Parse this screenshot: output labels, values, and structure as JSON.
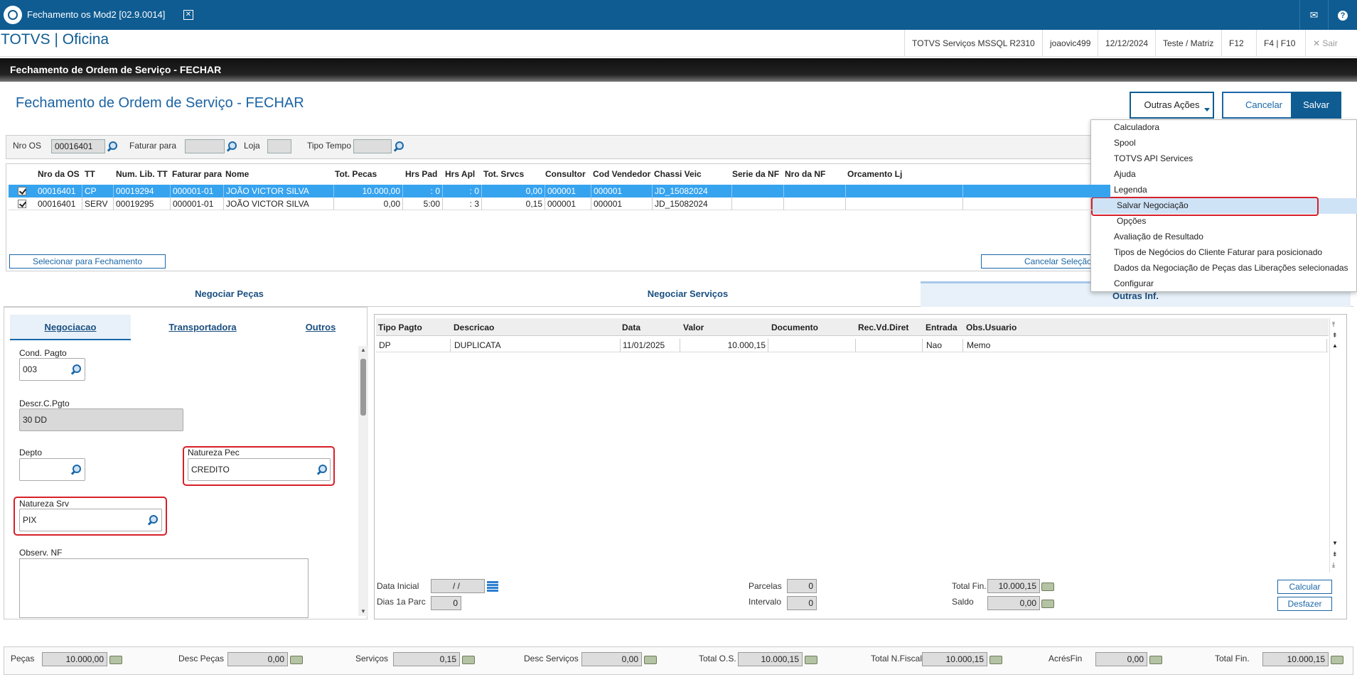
{
  "tab": {
    "title": "Fechamento os Mod2 [02.9.0014]"
  },
  "app": {
    "title": "TOTVS | Oficina"
  },
  "header": {
    "db": "TOTVS Serviços MSSQL R2310",
    "user": "joaovic499",
    "date": "12/12/2024",
    "branch": "Teste / Matriz",
    "f12": "F12",
    "f4f10": "F4 | F10",
    "exit": "Sair"
  },
  "bar": {
    "title": "Fechamento de Ordem de Serviço - FECHAR"
  },
  "page": {
    "title": "Fechamento de Ordem de Serviço - FECHAR"
  },
  "actions": {
    "outras": "Outras Ações",
    "cancelar": "Cancelar",
    "salvar": "Salvar"
  },
  "filter": {
    "nro_os_label": "Nro OS",
    "nro_os": "00016401",
    "faturar_label": "Faturar para",
    "loja_label": "Loja",
    "tipo_label": "Tipo Tempo"
  },
  "grid": {
    "headers": [
      "Nro da OS",
      "TT",
      "Num. Lib. TT",
      "Faturar para",
      "Nome",
      "Tot. Pecas",
      "Hrs Pad",
      "Hrs Apl",
      "Tot. Srvcs",
      "Consultor",
      "Cod Vendedor",
      "Chassi Veic",
      "Serie da NF",
      "Nro da NF",
      "Orcamento Lj"
    ],
    "rows": [
      [
        "00016401",
        "CP",
        "00019294",
        "000001-01",
        "JOÃO VICTOR SILVA",
        "10.000,00",
        ": 0",
        ": 0",
        "0,00",
        "000001",
        "000001",
        "JD_15082024"
      ],
      [
        "00016401",
        "SERV",
        "00019295",
        "000001-01",
        "JOÃO VICTOR SILVA",
        "0,00",
        "5:00",
        ": 3",
        "0,15",
        "000001",
        "000001",
        "JD_15082024"
      ]
    ],
    "select_btn": "Selecionar para Fechamento",
    "cancel_btn": "Cancelar Seleção"
  },
  "tabs": {
    "pecas": "Negociar Peças",
    "servicos": "Negociar Serviços",
    "outras": "Outras Inf."
  },
  "subtabs": {
    "negociacao": "Negociacao",
    "transportadora": "Transportadora",
    "outros": "Outros"
  },
  "form": {
    "cond_label": "Cond. Pagto",
    "cond": "003",
    "descr_label": "Descr.C.Pgto",
    "descr": "30 DD",
    "depto_label": "Depto",
    "natpec_label": "Natureza Pec",
    "natpec": "CREDITO",
    "natsrv_label": "Natureza Srv",
    "natsrv": "PIX",
    "obs_label": "Observ. NF"
  },
  "pay": {
    "headers": [
      "Tipo Pagto",
      "Descricao",
      "Data",
      "Valor",
      "Documento",
      "Rec.Vd.Diret",
      "Entrada",
      "Obs.Usuario"
    ],
    "row": [
      "DP",
      "DUPLICATA",
      "11/01/2025",
      "10.000,15",
      "",
      "",
      "Nao",
      "Memo"
    ],
    "data_inicial_label": "Data Inicial",
    "data_inicial": " /  /",
    "dias_label": "Dias 1a Parc",
    "dias": "0",
    "parcelas_label": "Parcelas",
    "parcelas": "0",
    "intervalo_label": "Intervalo",
    "intervalo": "0",
    "totalfin_label": "Total Fin.",
    "totalfin": "10.000,15",
    "saldo_label": "Saldo",
    "saldo": "0,00",
    "calcular": "Calcular",
    "desfazer": "Desfazer"
  },
  "menu": [
    "Calculadora",
    "Spool",
    "TOTVS API Services",
    "Ajuda",
    "Legenda",
    "Salvar Negociação",
    "Opções",
    "Avaliação de Resultado",
    "Tipos de Negócios do Cliente Faturar para posicionado",
    "Dados da Negociação de Peças das Liberações selecionadas",
    "Configurar"
  ],
  "footer": {
    "pecas_l": "Peças",
    "pecas": "10.000,00",
    "descp_l": "Desc Peças",
    "descp": "0,00",
    "serv_l": "Serviços",
    "serv": "0,15",
    "descs_l": "Desc Serviços",
    "descs": "0,00",
    "totos_l": "Total O.S.",
    "totos": "10.000,15",
    "totnf_l": "Total N.Fiscal",
    "totnf": "10.000,15",
    "acres_l": "AcrésFin",
    "acres": "0,00",
    "totfin_l": "Total Fin.",
    "totfin": "10.000,15"
  }
}
